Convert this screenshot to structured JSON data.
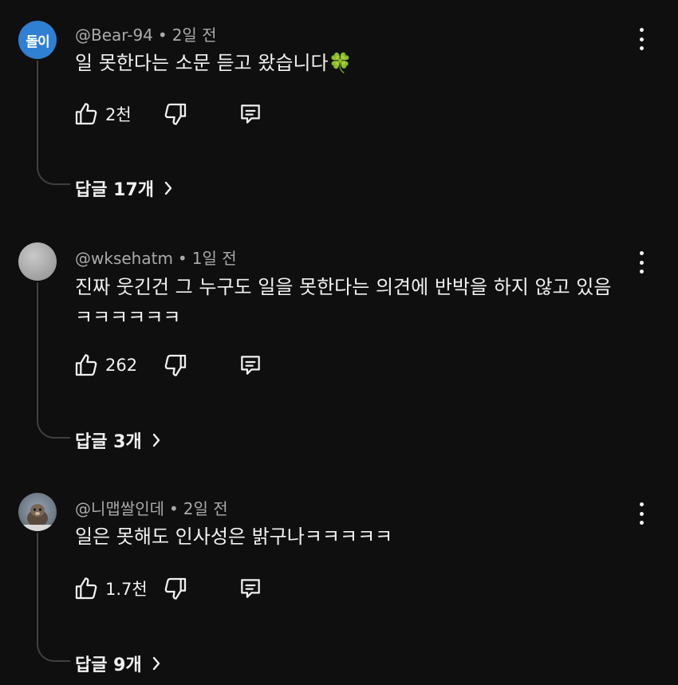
{
  "comments": [
    {
      "avatar_text": "돌이",
      "username": "@Bear-94",
      "time": "2일 전",
      "text": "일 못한다는 소문 듣고 왔습니다🍀",
      "likes": "2천",
      "replies_label": "답글 17개"
    },
    {
      "username": "@wksehatm",
      "time": "1일 전",
      "text": "진짜 웃긴건 그 누구도 일을 못한다는 의견에 반박을 하지 않고 있음ㅋㅋㅋㅋㅋㅋ",
      "likes": "262",
      "replies_label": "답글 3개"
    },
    {
      "username": "@니맵쌀인데",
      "time": "2일 전",
      "text": "일은 못해도 인사성은 밝구나ㅋㅋㅋㅋㅋ",
      "likes": "1.7천",
      "replies_label": "답글 9개"
    }
  ],
  "separator": "•",
  "icons": {
    "like": "thumbs-up-icon",
    "dislike": "thumbs-down-icon",
    "reply": "comment-reply-icon",
    "more": "more-vertical-icon",
    "chevron": "chevron-right-icon"
  },
  "colors": {
    "background": "#0f0f0f",
    "text": "#f1f1f1",
    "meta": "#aaaaaa",
    "avatar_blue": "#2f7fd3",
    "thread_line": "#3f3f3f"
  }
}
